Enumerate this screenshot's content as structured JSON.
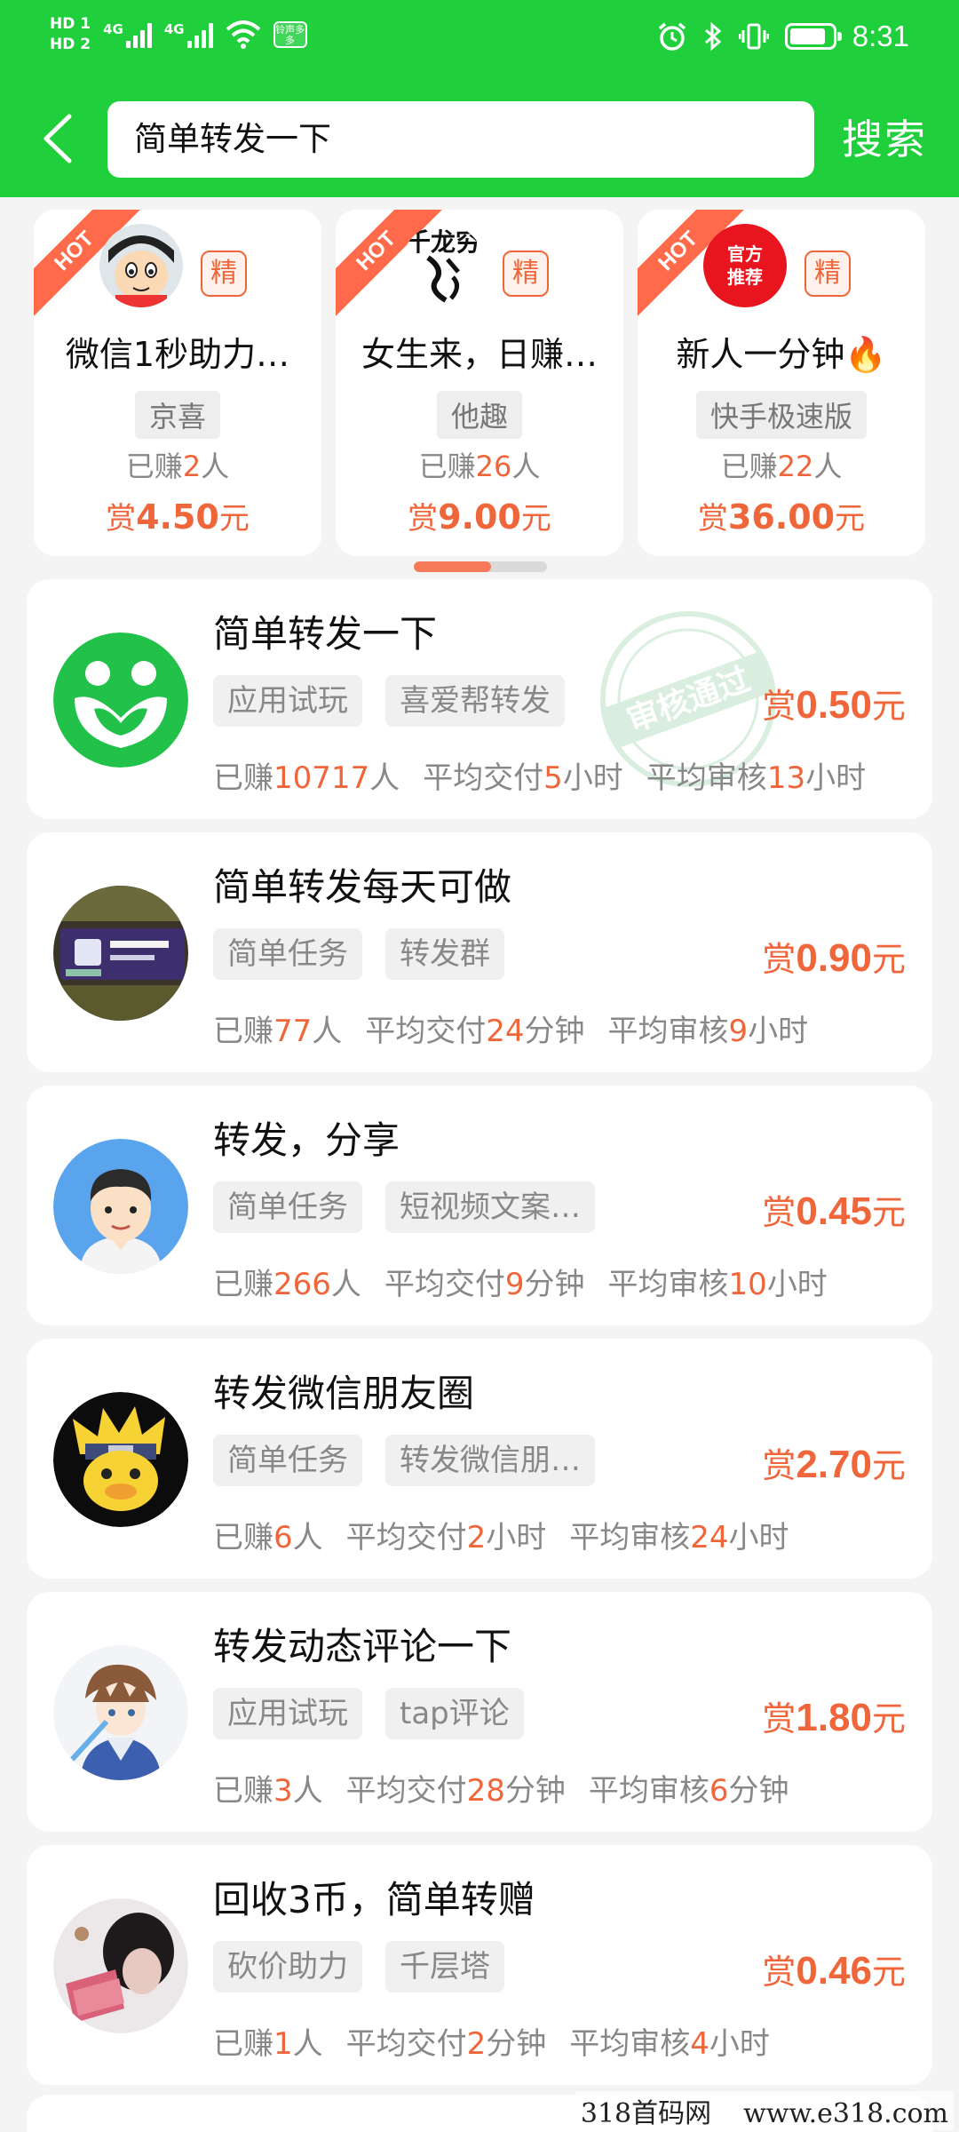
{
  "status_bar": {
    "hd1": "HD 1",
    "hd2": "HD 2",
    "net1": "4G",
    "net2": "4G",
    "app_icon_text": "铃声多多",
    "time": "8:31",
    "battery_level": 0.85
  },
  "header": {
    "search_query": "简单转发一下",
    "search_button": "搜索"
  },
  "hot_cards": [
    {
      "ribbon": "HOT",
      "badge": "精",
      "title": "微信1秒助力…",
      "tag": "京喜",
      "earned_prefix": "已赚",
      "earned_count": "2",
      "earned_suffix": "人",
      "reward_prefix": "赏",
      "reward_value": "4.50",
      "reward_unit": "元"
    },
    {
      "ribbon": "HOT",
      "badge": "精",
      "title": "女生来，日赚…",
      "tag": "他趣",
      "earned_prefix": "已赚",
      "earned_count": "26",
      "earned_suffix": "人",
      "reward_prefix": "赏",
      "reward_value": "9.00",
      "reward_unit": "元",
      "logo_text": "千龙穷"
    },
    {
      "ribbon": "HOT",
      "badge": "精",
      "title": "新人一分钟🔥",
      "tag": "快手极速版",
      "earned_prefix": "已赚",
      "earned_count": "22",
      "earned_suffix": "人",
      "reward_prefix": "赏",
      "reward_value": "36.00",
      "reward_unit": "元",
      "logo_line1": "官方",
      "logo_line2": "推荐"
    }
  ],
  "carousel_position": 0.58,
  "tasks": [
    {
      "title": "简单转发一下",
      "tags": [
        "应用试玩",
        "喜爱帮转发"
      ],
      "reward_prefix": "赏",
      "reward_value": "0.50",
      "reward_unit": "元",
      "earned_prefix": "已赚",
      "earned_count": "10717",
      "earned_suffix": "人",
      "delivery_prefix": "平均交付",
      "delivery_num": "5",
      "delivery_unit": "小时",
      "review_prefix": "平均审核",
      "review_num": "13",
      "review_unit": "小时",
      "stamp": "审核通过",
      "avatar": "green-heart-logo"
    },
    {
      "title": "简单转发每天可做",
      "tags": [
        "简单任务",
        "转发群"
      ],
      "reward_prefix": "赏",
      "reward_value": "0.90",
      "reward_unit": "元",
      "earned_prefix": "已赚",
      "earned_count": "77",
      "earned_suffix": "人",
      "delivery_prefix": "平均交付",
      "delivery_num": "24",
      "delivery_unit": "分钟",
      "review_prefix": "平均审核",
      "review_num": "9",
      "review_unit": "小时",
      "avatar": "product-photo"
    },
    {
      "title": "转发，分享",
      "tags": [
        "简单任务",
        "短视频文案…"
      ],
      "reward_prefix": "赏",
      "reward_value": "0.45",
      "reward_unit": "元",
      "earned_prefix": "已赚",
      "earned_count": "266",
      "earned_suffix": "人",
      "delivery_prefix": "平均交付",
      "delivery_num": "9",
      "delivery_unit": "分钟",
      "review_prefix": "平均审核",
      "review_num": "10",
      "review_unit": "小时",
      "avatar": "cartoon-man"
    },
    {
      "title": "转发微信朋友圈",
      "tags": [
        "简单任务",
        "转发微信朋…"
      ],
      "reward_prefix": "赏",
      "reward_value": "2.70",
      "reward_unit": "元",
      "earned_prefix": "已赚",
      "earned_count": "6",
      "earned_suffix": "人",
      "delivery_prefix": "平均交付",
      "delivery_num": "2",
      "delivery_unit": "小时",
      "review_prefix": "平均审核",
      "review_num": "24",
      "review_unit": "小时",
      "avatar": "ninja-duck"
    },
    {
      "title": "转发动态评论一下",
      "tags": [
        "应用试玩",
        "tap评论"
      ],
      "reward_prefix": "赏",
      "reward_value": "1.80",
      "reward_unit": "元",
      "earned_prefix": "已赚",
      "earned_count": "3",
      "earned_suffix": "人",
      "delivery_prefix": "平均交付",
      "delivery_num": "28",
      "delivery_unit": "分钟",
      "review_prefix": "平均审核",
      "review_num": "6",
      "review_unit": "分钟",
      "avatar": "anime-character"
    },
    {
      "title": "回收3币，简单转赠",
      "tags": [
        "砍价助力",
        "千层塔"
      ],
      "reward_prefix": "赏",
      "reward_value": "0.46",
      "reward_unit": "元",
      "earned_prefix": "已赚",
      "earned_count": "1",
      "earned_suffix": "人",
      "delivery_prefix": "平均交付",
      "delivery_num": "2",
      "delivery_unit": "分钟",
      "review_prefix": "平均审核",
      "review_num": "4",
      "review_unit": "小时",
      "avatar": "money-photo"
    }
  ],
  "watermark": {
    "left": "318首码网",
    "right": "www.e318.com"
  },
  "colors": {
    "brand_green": "#1fcf3c",
    "accent_orange": "#f0663b",
    "background": "#f4f4f4"
  }
}
